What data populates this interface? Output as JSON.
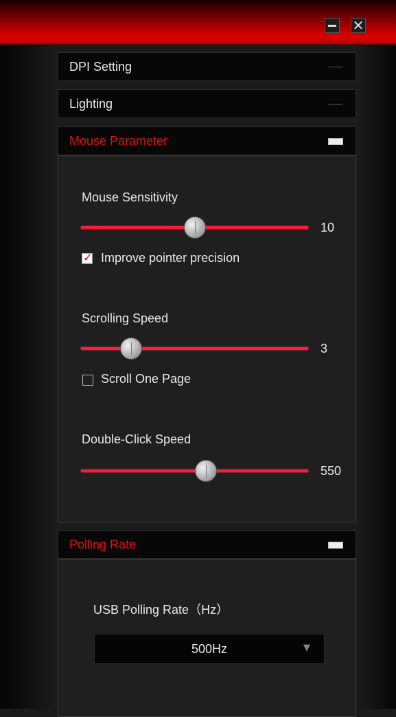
{
  "window": {
    "minimize_glyph": "",
    "close_glyph": "✕"
  },
  "sections": {
    "dpi": {
      "title": "DPI Setting"
    },
    "lighting": {
      "title": "Lighting"
    },
    "mouse_parameter": {
      "title": "Mouse Parameter",
      "sensitivity": {
        "label": "Mouse Sensitivity",
        "value": "10",
        "fraction": 0.5
      },
      "pointer_precision": {
        "label": "Improve pointer precision",
        "checked": true
      },
      "scrolling": {
        "label": "Scrolling Speed",
        "value": "3",
        "fraction": 0.22
      },
      "scroll_one_page": {
        "label": "Scroll One Page",
        "checked": false
      },
      "double_click": {
        "label": "Double-Click Speed",
        "value": "550",
        "fraction": 0.55
      }
    },
    "polling_rate": {
      "title": "Polling Rate",
      "usb_label": "USB Polling Rate（Hz）",
      "selected": "500Hz",
      "arrow": "▼"
    }
  },
  "colors": {
    "accent": "#e01010",
    "slider_track": "#ff1a3d"
  }
}
